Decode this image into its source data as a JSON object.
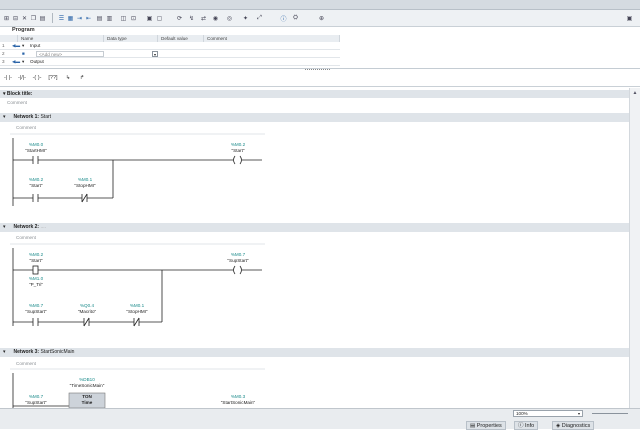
{
  "toolbar": {
    "icons": [
      "insert-row-icon",
      "add-row-icon",
      "delete-row-icon",
      "copy-icon",
      "paste-icon",
      "list-icon",
      "list-detailed-icon",
      "indent-icon",
      "outdent-icon",
      "sort-asc-icon",
      "sort-desc-icon",
      "monitor-icon",
      "breakpoint-icon",
      "step-icon",
      "network-icon",
      "goto-icon",
      "navigate-icon",
      "compare-icon",
      "open-icon",
      "close-icon",
      "favorites-icon"
    ]
  },
  "interface": {
    "title": "Program",
    "columns": [
      "Name",
      "Data type",
      "Default value",
      "Comment"
    ],
    "rows": [
      {
        "num": "1",
        "label": "Input",
        "kind": "section"
      },
      {
        "num": "2",
        "label": "<Add new>",
        "kind": "add"
      },
      {
        "num": "3",
        "label": "Output",
        "kind": "section"
      }
    ]
  },
  "ladder_toolbar": [
    "-| |-",
    "-|/|-",
    "-( )-",
    "[??]",
    "↳",
    "↱"
  ],
  "block": {
    "title_label": "Block title:",
    "title_value": "",
    "comment": "Comment"
  },
  "networks": [
    {
      "label": "Network 1:",
      "title": "Start",
      "comment": "Comment",
      "contacts": [
        {
          "addr": "%M0.0",
          "tag": "\"StartHMI\""
        },
        {
          "addr": "%M0.2",
          "tag": "\"Start\""
        },
        {
          "addr": "%M0.1",
          "tag": "\"StopHMI\""
        }
      ],
      "coil": {
        "addr": "%M0.2",
        "tag": "\"Start\""
      }
    },
    {
      "label": "Network 2:",
      "title": "....",
      "comment": "Comment",
      "contacts": [
        {
          "addr": "%M0.2",
          "tag": "\"Start\""
        },
        {
          "addr": "%M1.0",
          "tag": "\"P_Tri\""
        },
        {
          "addr": "%M0.7",
          "tag": "\"SupStart\""
        },
        {
          "addr": "%Q0.4",
          "tag": "\"Macrito\""
        },
        {
          "addr": "%M0.1",
          "tag": "\"StopHMI\""
        }
      ],
      "coil": {
        "addr": "%M0.7",
        "tag": "\"SupStart\""
      }
    },
    {
      "label": "Network 3:",
      "title": "StartSonicMain",
      "comment": "Comment",
      "timer": {
        "addr": "%DB10",
        "tag": "\"TimeSonicMain\"",
        "type": "TON",
        "subtype": "Time"
      },
      "contacts": [
        {
          "addr": "%M0.7",
          "tag": "\"SupStart\""
        }
      ],
      "coil": {
        "addr": "%M0.3",
        "tag": "\"StartSonicMain\""
      }
    }
  ],
  "status": {
    "zoom": "100%",
    "tabs": [
      "Properties",
      "Info",
      "Diagnostics"
    ]
  },
  "colors": {
    "address": "#1a8a8a",
    "header": "#dfe4e9",
    "accent": "#2a64a8"
  }
}
